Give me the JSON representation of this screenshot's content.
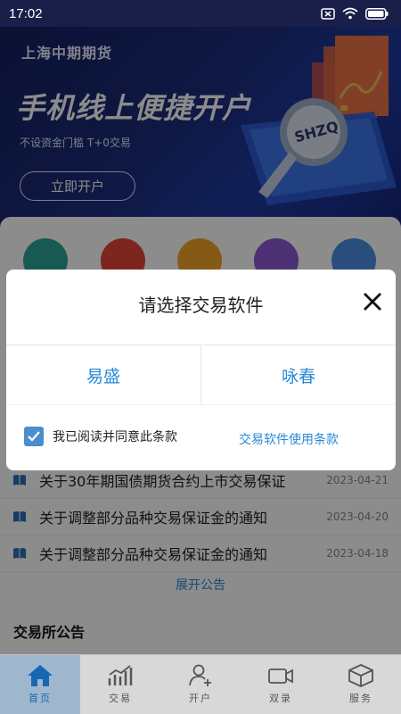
{
  "status_bar": {
    "time": "17:02"
  },
  "banner": {
    "brand": "上海中期期货",
    "headline": "手机线上便捷开户",
    "subtitle": "不设资金门槛 T+0交易",
    "cta": "立即开户",
    "badge_text": "SHZQ"
  },
  "notices": [
    {
      "title": "关于30年期国债期货合约上市交易保证",
      "date": "2023-04-21"
    },
    {
      "title": "关于调整部分品种交易保证金的通知",
      "date": "2023-04-20"
    },
    {
      "title": "关于调整部分品种交易保证金的通知",
      "date": "2023-04-18"
    }
  ],
  "expand_label": "展开公告",
  "section_title": "交易所公告",
  "tabs": [
    {
      "label": "首页",
      "icon": "home-icon",
      "active": true
    },
    {
      "label": "交易",
      "icon": "chart-icon",
      "active": false
    },
    {
      "label": "开户",
      "icon": "add-user-icon",
      "active": false
    },
    {
      "label": "双录",
      "icon": "video-icon",
      "active": false
    },
    {
      "label": "服务",
      "icon": "box-icon",
      "active": false
    }
  ],
  "modal": {
    "title": "请选择交易软件",
    "options": [
      "易盛",
      "咏春"
    ],
    "agree_text": "我已阅读并同意此条款",
    "terms_link": "交易软件使用条款",
    "agree_checked": true
  },
  "colors": {
    "accent": "#2a88d6",
    "banner_bg": "#1c2d7c",
    "checkbox": "#4a8ecf"
  }
}
